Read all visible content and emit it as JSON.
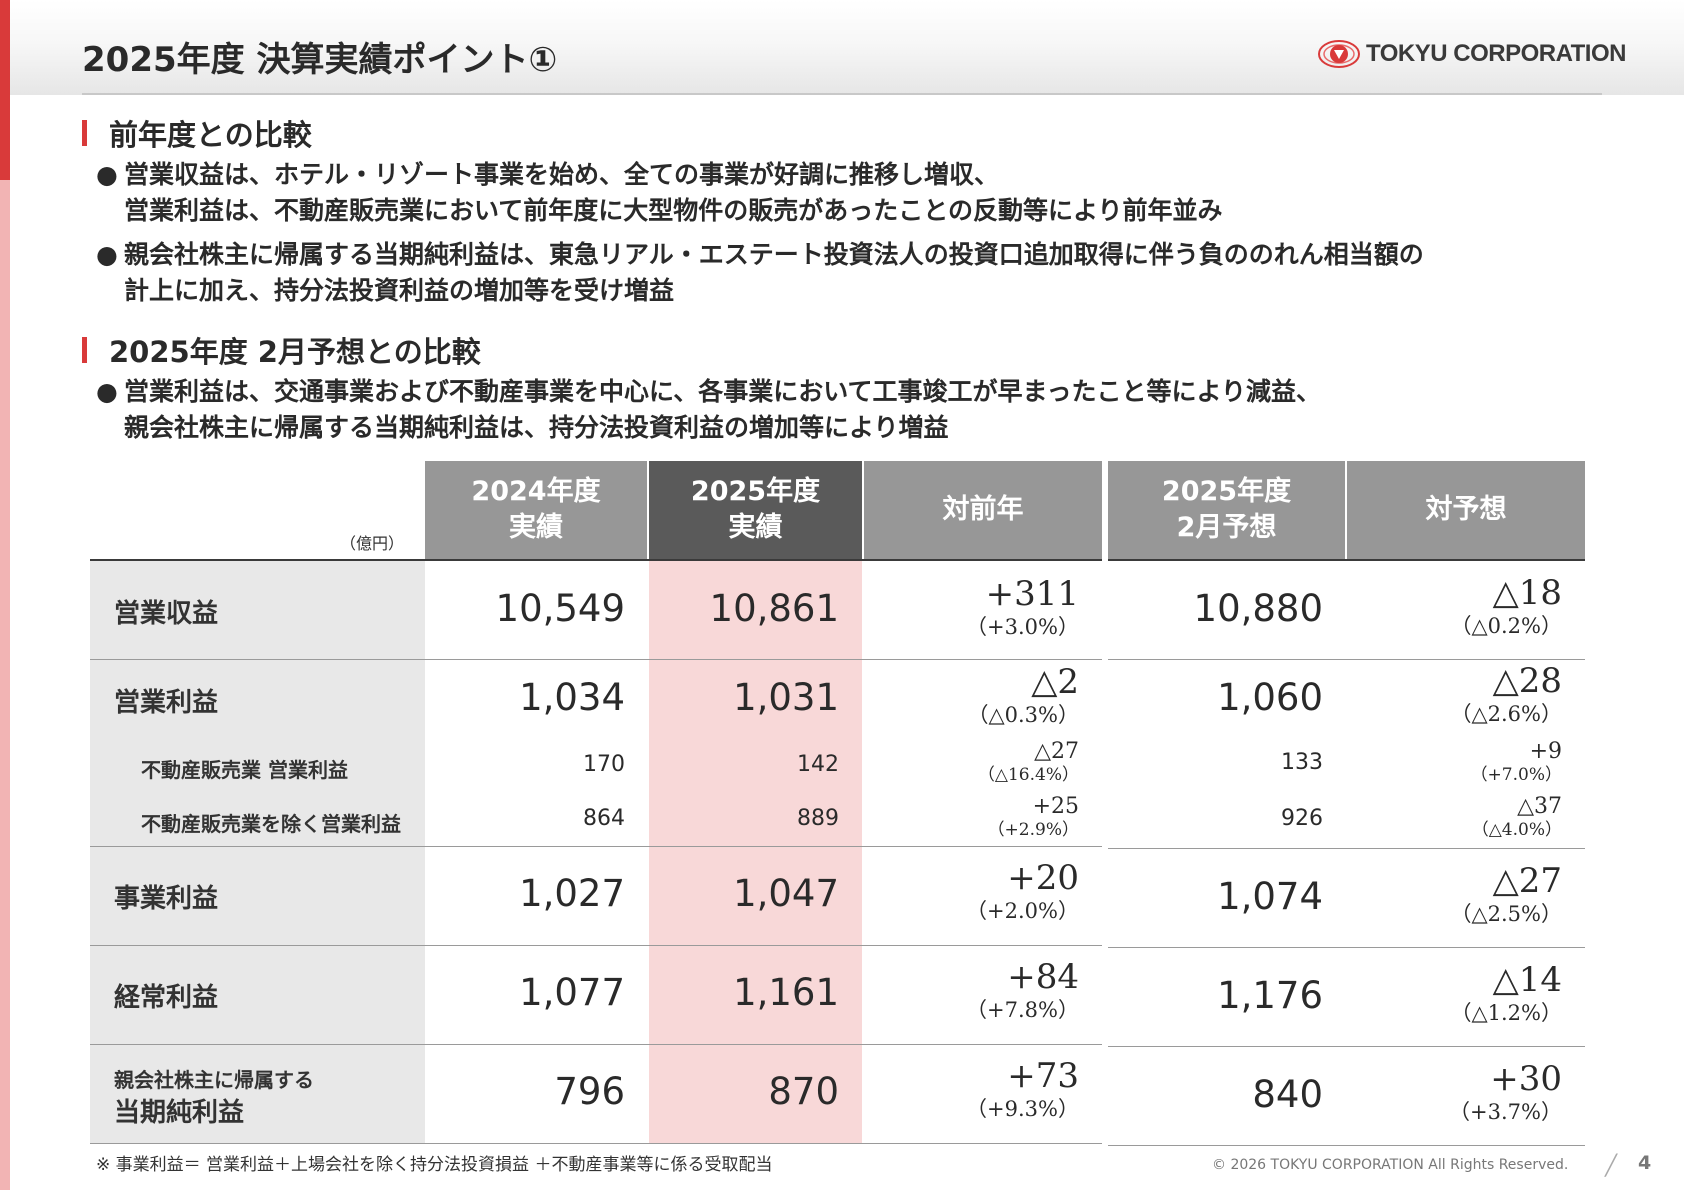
{
  "header": {
    "title": "2025年度 決算実績ポイント①",
    "logo_text": "TOKYU CORPORATION"
  },
  "sections": [
    {
      "heading": "前年度との比較",
      "bullets": [
        {
          "line1": "営業収益は、ホテル・リゾート事業を始め、全ての事業が好調に推移し増収、",
          "line2": "営業利益は、不動産販売業において前年度に大型物件の販売があったことの反動等により前年並み"
        },
        {
          "line1": "親会社株主に帰属する当期純利益は、東急リアル・エステート投資法人の投資口追加取得に伴う負ののれん相当額の",
          "line2": "計上に加え、持分法投資利益の増加等を受け増益"
        }
      ]
    },
    {
      "heading": "2025年度 2月予想との比較",
      "bullets": [
        {
          "line1": "営業利益は、交通事業および不動産事業を中心に、各事業において工事竣工が早まったこと等により減益、",
          "line2": "親会社株主に帰属する当期純利益は、持分法投資利益の増加等により増益"
        }
      ]
    }
  ],
  "table": {
    "unit": "（億円）",
    "headers": {
      "fy2024": {
        "l1": "2024年度",
        "l2": "実績"
      },
      "fy2025": {
        "l1": "2025年度",
        "l2": "実績"
      },
      "yoy": {
        "l1": "対前年"
      },
      "forecast": {
        "l1": "2025年度",
        "l2": "2月予想"
      },
      "vs_forecast": {
        "l1": "対予想"
      }
    },
    "rows": [
      {
        "label": "営業収益",
        "fy2024": "10,549",
        "fy2025": "10,861",
        "yoy": "+311",
        "yoy_pct": "（+3.0%）",
        "forecast": "10,880",
        "vs": "△18",
        "vs_pct": "（△0.2%）"
      },
      {
        "label": "営業利益",
        "fy2024": "1,034",
        "fy2025": "1,031",
        "yoy": "△2",
        "yoy_pct": "（△0.3%）",
        "forecast": "1,060",
        "vs": "△28",
        "vs_pct": "（△2.6%）"
      },
      {
        "label": "不動産販売業 営業利益",
        "fy2024": "170",
        "fy2025": "142",
        "yoy": "△27",
        "yoy_pct": "（△16.4%）",
        "forecast": "133",
        "vs": "+9",
        "vs_pct": "（+7.0%）"
      },
      {
        "label": "不動産販売業を除く営業利益",
        "fy2024": "864",
        "fy2025": "889",
        "yoy": "+25",
        "yoy_pct": "（+2.9%）",
        "forecast": "926",
        "vs": "△37",
        "vs_pct": "（△4.0%）"
      },
      {
        "label": "事業利益",
        "fy2024": "1,027",
        "fy2025": "1,047",
        "yoy": "+20",
        "yoy_pct": "（+2.0%）",
        "forecast": "1,074",
        "vs": "△27",
        "vs_pct": "（△2.5%）"
      },
      {
        "label": "経常利益",
        "fy2024": "1,077",
        "fy2025": "1,161",
        "yoy": "+84",
        "yoy_pct": "（+7.8%）",
        "forecast": "1,176",
        "vs": "△14",
        "vs_pct": "（△1.2%）"
      },
      {
        "label_l1": "親会社株主に帰属する",
        "label_l2": "当期純利益",
        "fy2024": "796",
        "fy2025": "870",
        "yoy": "+73",
        "yoy_pct": "（+9.3%）",
        "forecast": "840",
        "vs": "+30",
        "vs_pct": "（+3.7%）"
      }
    ]
  },
  "footer": {
    "note": "※ 事業利益＝ 営業利益＋上場会社を除く持分法投資損益 ＋不動産事業等に係る受取配当",
    "copyright": "© 2026 TOKYU CORPORATION All Rights Reserved.",
    "page": "4"
  },
  "colors": {
    "accent": "#d93a3a",
    "accent_light": "#f2b4b4",
    "header_gray": "#979797",
    "header_dark": "#5a5a5a",
    "highlight_pink": "#f8d8d8",
    "label_gray": "#e8e8e8"
  }
}
